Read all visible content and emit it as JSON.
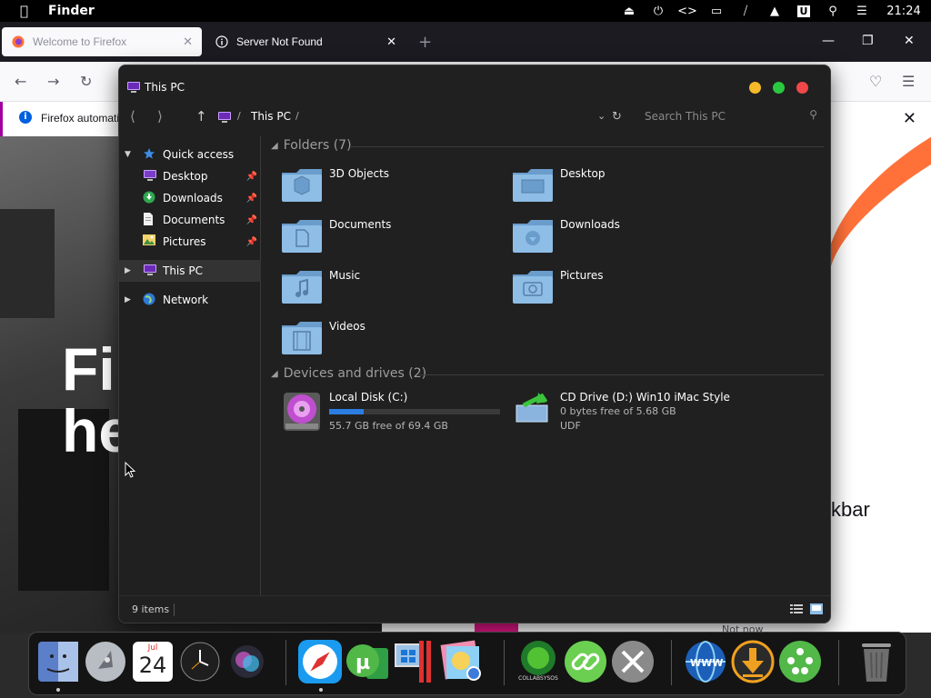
{
  "menubar": {
    "app_name": "Finder",
    "clock": "21:24",
    "status_icons": [
      "eject-icon",
      "power-icon",
      "dev-icon",
      "display-icon",
      "mute-icon",
      "upload-icon",
      "u-icon",
      "search-icon",
      "control-center-icon"
    ]
  },
  "firefox": {
    "tabs": [
      {
        "title": "Welcome to Firefox",
        "active": true
      },
      {
        "title": "Server Not Found",
        "active": false
      }
    ],
    "infobar_text": "Firefox automati",
    "page_heading_line1": "Fir",
    "page_heading_line2": "he",
    "page_side_text": "kbar",
    "page_footer_text": "Not now"
  },
  "explorer": {
    "window_title": "This PC",
    "breadcrumb": "This PC",
    "breadcrumb_sep": "/",
    "search_placeholder": "Search This PC",
    "sidebar": {
      "quick_access": "Quick access",
      "quick_items": [
        {
          "label": "Desktop"
        },
        {
          "label": "Downloads"
        },
        {
          "label": "Documents"
        },
        {
          "label": "Pictures"
        }
      ],
      "this_pc": "This PC",
      "network": "Network"
    },
    "folders_header": "Folders (7)",
    "folders": [
      {
        "label": "3D Objects",
        "glyph": "3D"
      },
      {
        "label": "Desktop",
        "glyph": "desk"
      },
      {
        "label": "Documents",
        "glyph": "doc"
      },
      {
        "label": "Downloads",
        "glyph": "down"
      },
      {
        "label": "Music",
        "glyph": "music"
      },
      {
        "label": "Pictures",
        "glyph": "pic"
      },
      {
        "label": "Videos",
        "glyph": "video"
      }
    ],
    "drives_header": "Devices and drives (2)",
    "drives": [
      {
        "label": "Local Disk (C:)",
        "free_text": "55.7 GB free of 69.4 GB",
        "used_fraction": 0.2
      },
      {
        "label": "CD Drive (D:) Win10 iMac Style",
        "free_text": "0 bytes free of 5.68 GB",
        "fs": "UDF"
      }
    ],
    "status_items": "9 items"
  },
  "calendar": {
    "month": "Jul",
    "day": "24"
  },
  "dock_labels": {
    "collabsysos": "COLLABSYSOS"
  },
  "colors": {
    "accent_blue": "#2b7de1",
    "folder_blue": "#7fb2e0",
    "traffic_yellow": "#f5b92a",
    "traffic_green": "#2ac840",
    "traffic_red": "#f0484a"
  }
}
